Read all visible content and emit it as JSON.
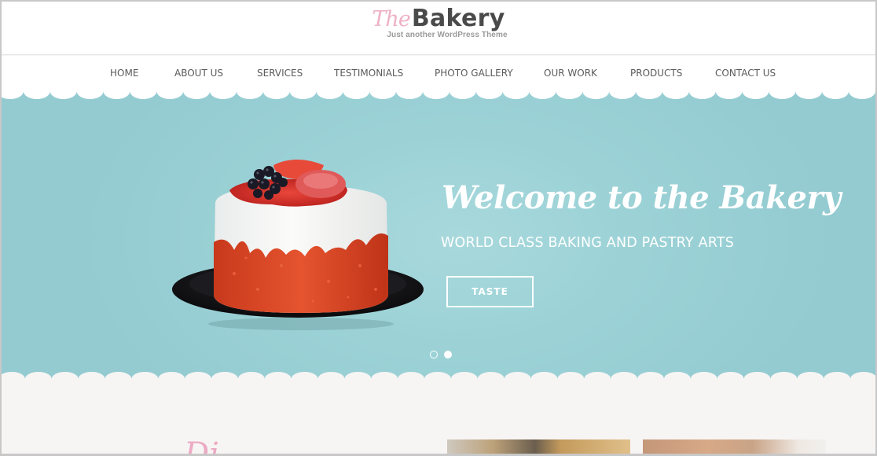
{
  "header": {
    "logo_prefix": "The",
    "logo_name": "Bakery",
    "tagline": "Just another WordPress Theme"
  },
  "nav": {
    "items": [
      {
        "label": "HOME"
      },
      {
        "label": "ABOUT US"
      },
      {
        "label": "SERVICES"
      },
      {
        "label": "TESTIMONIALS"
      },
      {
        "label": "PHOTO GALLERY"
      },
      {
        "label": "OUR WORK"
      },
      {
        "label": "PRODUCTS"
      },
      {
        "label": "CONTACT US"
      }
    ]
  },
  "hero": {
    "title": "Welcome to the Bakery",
    "subtitle": "WORLD CLASS BAKING AND PASTRY ARTS",
    "button_label": "TASTE",
    "image": "cake-with-berries",
    "slides_total": 2,
    "active_slide": 2
  },
  "section": {
    "heading_fragment": "Di"
  },
  "colors": {
    "accent_pink": "#ecaac4",
    "hero_teal": "#9dd3d7",
    "logo_dark": "#4a4a4a"
  }
}
